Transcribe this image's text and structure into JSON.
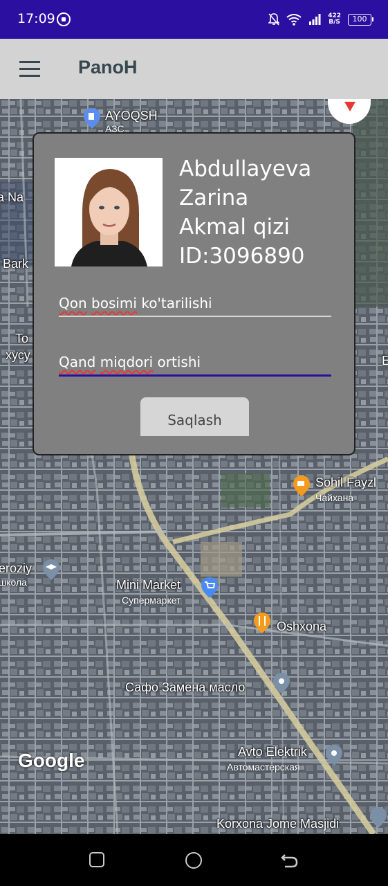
{
  "status_bar": {
    "time": "17:09",
    "net_speed_top": "422",
    "net_speed_bottom": "B/S",
    "battery": "100",
    "icons": [
      "record-icon",
      "bell-off-icon",
      "wifi-icon",
      "signal-icon",
      "battery-icon"
    ]
  },
  "app_bar": {
    "title": "PanoH",
    "menu_icon": "hamburger-menu-icon"
  },
  "map": {
    "labels": {
      "ayoqsh": "AYOQSH",
      "ayoqsh_sub": "АЗС",
      "na": "a Na",
      "bark": "Bark",
      "to": "To",
      "xusu": "xусу",
      "sohil": "Sohil Fayzl",
      "sohil_sub": "Чайхана",
      "eroziy": "eroziy",
      "eroziy_sub": "школа",
      "mini_market": "Mini Market",
      "mini_market_sub": "Супермаркет",
      "oshxona": "Oshxona",
      "safo": "Сафо Замена масло",
      "avto": "Avto Elektrik",
      "avto_sub": "Автомастерская",
      "korxona": "Korxona Jome Masjidi",
      "e_edge": "E"
    },
    "logo": "Google"
  },
  "dialog": {
    "name_lines": [
      "Abdullayeva",
      "Zarina",
      "Akmal qizi",
      "ID:3096890"
    ],
    "field1": {
      "word1": "Qon",
      "word2": "bosimi",
      "rest": " ko'tarilishi"
    },
    "field2": {
      "word1": "Qand",
      "word2": "miqdori",
      "rest": " ortishi"
    },
    "save_label": "Saqlash"
  },
  "colors": {
    "status_bar": "#2a0fa0",
    "app_bar": "#d3d3d3",
    "dialog": "#808080",
    "accent_line": "#2a0fa0"
  }
}
